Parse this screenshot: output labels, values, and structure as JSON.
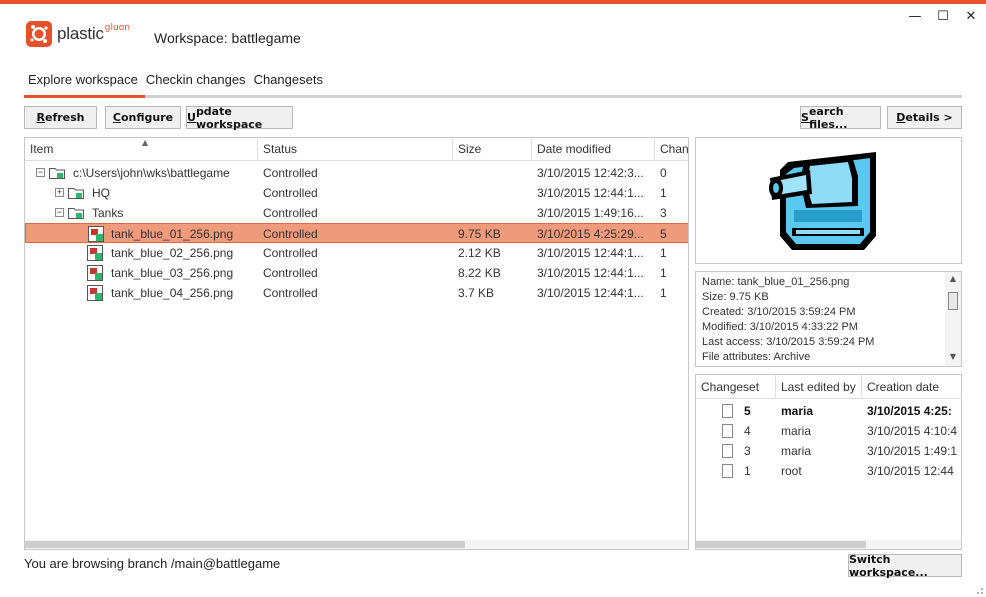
{
  "window": {
    "minimize": "—",
    "maximize": "☐",
    "close": "✕"
  },
  "logo": {
    "name": "plastic",
    "sup": "gluon"
  },
  "workspace_title": "Workspace: battlegame",
  "tabs": [
    {
      "label": "Explore workspace",
      "active": true
    },
    {
      "label": "Checkin changes",
      "active": false
    },
    {
      "label": "Changesets",
      "active": false
    }
  ],
  "toolbar": {
    "refresh": {
      "first": "R",
      "rest": "efresh"
    },
    "configure": {
      "first": "C",
      "rest": "onfigure"
    },
    "update": {
      "first": "U",
      "rest": "pdate workspace"
    },
    "search": {
      "first": "S",
      "rest": "earch files..."
    },
    "details": {
      "first": "D",
      "rest": "etails >"
    }
  },
  "tree": {
    "columns": [
      "Item",
      "Status",
      "Size",
      "Date modified",
      "Chan"
    ],
    "rows": [
      {
        "name": "c:\\Users\\john\\wks\\battlegame",
        "status": "Controlled",
        "size": "",
        "date": "3/10/2015 12:42:3...",
        "changeset": "0",
        "kind": "folder",
        "expander": "−"
      },
      {
        "name": "HQ",
        "status": "Controlled",
        "size": "",
        "date": "3/10/2015 12:44:1...",
        "changeset": "1",
        "kind": "folder",
        "expander": "+"
      },
      {
        "name": "Tanks",
        "status": "Controlled",
        "size": "",
        "date": "3/10/2015 1:49:16...",
        "changeset": "3",
        "kind": "folder",
        "expander": "−"
      },
      {
        "name": "tank_blue_01_256.png",
        "status": "Controlled",
        "size": "9.75 KB",
        "date": "3/10/2015 4:25:29...",
        "changeset": "5",
        "kind": "file",
        "selected": true
      },
      {
        "name": "tank_blue_02_256.png",
        "status": "Controlled",
        "size": "2.12 KB",
        "date": "3/10/2015 12:44:1...",
        "changeset": "1",
        "kind": "file"
      },
      {
        "name": "tank_blue_03_256.png",
        "status": "Controlled",
        "size": "8.22 KB",
        "date": "3/10/2015 12:44:1...",
        "changeset": "1",
        "kind": "file"
      },
      {
        "name": "tank_blue_04_256.png",
        "status": "Controlled",
        "size": "3.7 KB",
        "date": "3/10/2015 12:44:1...",
        "changeset": "1",
        "kind": "file"
      }
    ]
  },
  "properties": {
    "lines": [
      "Name: tank_blue_01_256.png",
      "Size: 9.75 KB",
      "Created: 3/10/2015 3:59:24 PM",
      "Modified: 3/10/2015 4:33:22 PM",
      "Last access: 3/10/2015 3:59:24 PM",
      "File attributes: Archive"
    ]
  },
  "history": {
    "columns": [
      "Changeset",
      "Last edited by",
      "Creation date"
    ],
    "rows": [
      {
        "changeset": "5",
        "user": "maria",
        "date": "3/10/2015 4:25:",
        "bold": true
      },
      {
        "changeset": "4",
        "user": "maria",
        "date": "3/10/2015 4:10:4",
        "bold": false
      },
      {
        "changeset": "3",
        "user": "maria",
        "date": "3/10/2015 1:49:1",
        "bold": false
      },
      {
        "changeset": "1",
        "user": "root",
        "date": "3/10/2015 12:44",
        "bold": false
      }
    ]
  },
  "status_text": "You are browsing branch /main@battlegame",
  "switch_button": "Switch workspace...",
  "colors": {
    "accent": "#e4512a",
    "selection": "#f09a7c",
    "tank_blue": "#5ac8f0"
  }
}
